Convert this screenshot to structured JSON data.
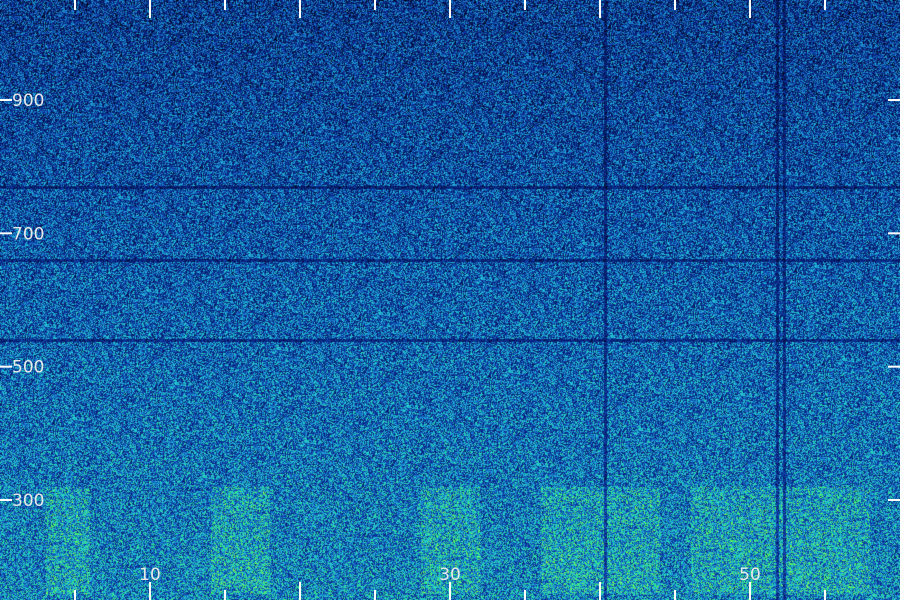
{
  "chart_data": {
    "type": "heatmap",
    "title": "",
    "xlabel": "",
    "ylabel": "",
    "x_ticks": [
      "10",
      "30",
      "50"
    ],
    "x_tick_values": [
      10,
      30,
      50
    ],
    "xlim": [
      0,
      60
    ],
    "y_ticks": [
      "900",
      "700",
      "500",
      "300"
    ],
    "y_tick_values": [
      900,
      700,
      500,
      300
    ],
    "ylim": [
      150,
      1050
    ],
    "colormap": [
      "#000514",
      "#061a6e",
      "#0a3aa0",
      "#1a74c8",
      "#22c8d8",
      "#3af070",
      "#b4ff3c"
    ],
    "band_x_ranges": [
      [
        3,
        6
      ],
      [
        14,
        18
      ],
      [
        28,
        32
      ],
      [
        36,
        44
      ],
      [
        46,
        58
      ]
    ],
    "band_y_range": [
      160,
      320
    ],
    "dark_vertical_lines_x": [
      40.3,
      51.8,
      52.3
    ],
    "dark_horizontal_lines_y": [
      540,
      660,
      770
    ],
    "grid": false
  }
}
